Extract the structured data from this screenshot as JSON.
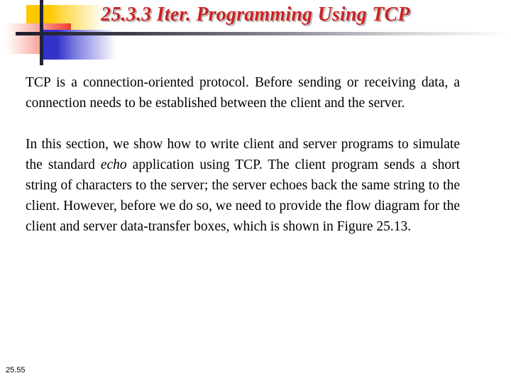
{
  "slide": {
    "title": "25.3.3  Iter. Programming Using TCP",
    "footer": "25.55",
    "colors": {
      "title_red": "#CC2222",
      "title_shadow": "#B9B9B9",
      "deco_yellow": "#FFC800",
      "deco_red": "#F03A2E",
      "deco_blue": "#3333CC",
      "deco_line": "#23233C",
      "body_text": "#000000",
      "background": "#FFFFFF"
    },
    "paragraphs": [
      {
        "id": "paragraph-1",
        "text": "TCP is a connection-oriented protocol. Before sending or receiving data, a connection needs to be established between the client and the server."
      },
      {
        "id": "paragraph-2",
        "segments": [
          {
            "text": "In this section, we show how to write client and server programs to simulate the standard ",
            "style": "normal"
          },
          {
            "text": "echo",
            "style": "italic"
          },
          {
            "text": " application using TCP. The client program sends a short string of characters to the server; the server echoes back the same string to the client. However, before we do so, we need to provide the flow diagram for the client and server data-transfer boxes, which is shown in Figure 25.13.",
            "style": "normal"
          }
        ]
      }
    ]
  }
}
